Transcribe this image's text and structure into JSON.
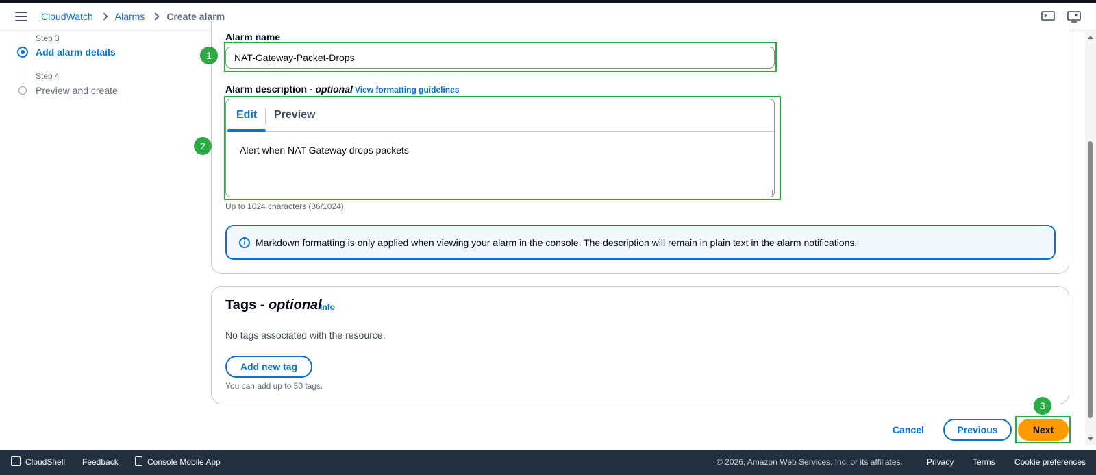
{
  "breadcrumb": {
    "items": [
      {
        "label": "CloudWatch"
      },
      {
        "label": "Alarms"
      }
    ],
    "current": "Create alarm"
  },
  "steps": [
    {
      "small": "Step 3",
      "label": "Add alarm details",
      "state": "active"
    },
    {
      "small": "Step 4",
      "label": "Preview and create",
      "state": "pending"
    }
  ],
  "alarm_name": {
    "label": "Alarm name",
    "value": "NAT-Gateway-Packet-Drops"
  },
  "alarm_description": {
    "label": "Alarm description - ",
    "optional": "optional",
    "guidelines_link": "View formatting guidelines",
    "tabs": [
      "Edit",
      "Preview"
    ],
    "value": "Alert when NAT Gateway drops packets",
    "hint": "Up to 1024 characters (36/1024)."
  },
  "markdown_alert": {
    "text": "Markdown formatting is only applied when viewing your alarm in the console. The description will remain in plain text in the alarm notifications."
  },
  "tags": {
    "title": "Tags - ",
    "optional": "optional",
    "info": "Info",
    "empty": "No tags associated with the resource.",
    "add_button": "Add new tag",
    "hint": "You can add up to 50 tags."
  },
  "actions": {
    "cancel": "Cancel",
    "previous": "Previous",
    "next": "Next"
  },
  "annotations": [
    "1",
    "2",
    "3"
  ],
  "footer": {
    "cloudshell": "CloudShell",
    "feedback": "Feedback",
    "mobile_app": "Console Mobile App",
    "copyright": "© 2026, Amazon Web Services, Inc. or its affiliates.",
    "privacy": "Privacy",
    "terms": "Terms",
    "cookies": "Cookie preferences"
  },
  "colors": {
    "accent": "#0972d3",
    "primary_button": "#ff9900",
    "highlight": "#2eaa44",
    "footer_bg": "#232f3e"
  }
}
